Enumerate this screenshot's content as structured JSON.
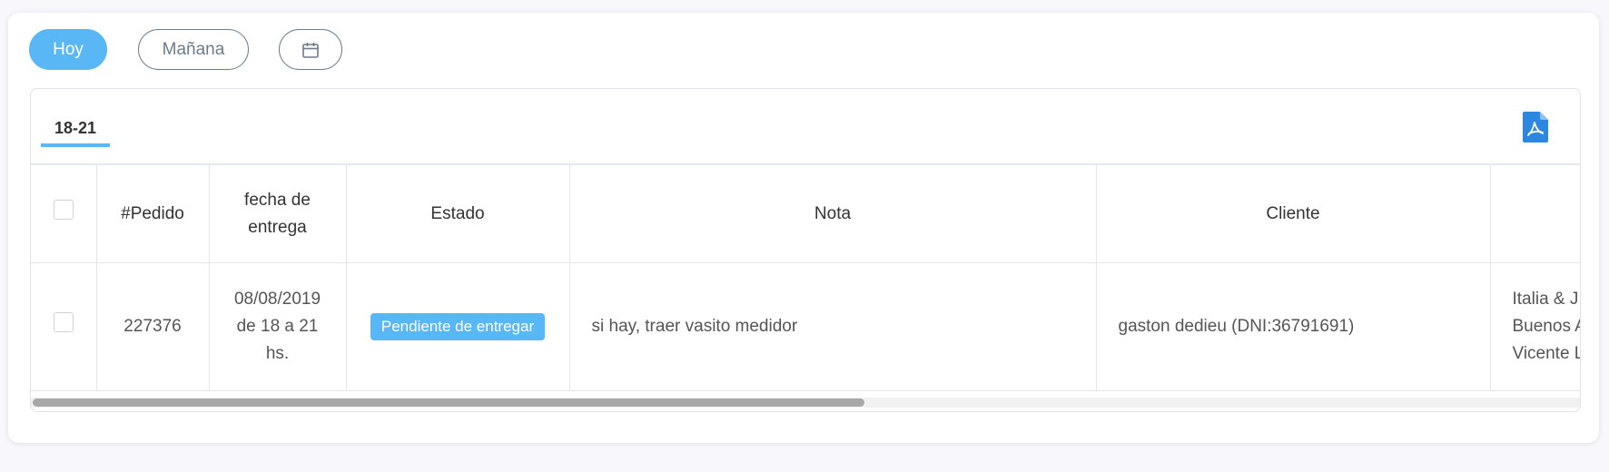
{
  "filters": {
    "hoy_label": "Hoy",
    "manana_label": "Mañana",
    "calendar_icon": "calendar-icon",
    "active_color": "#5ab7f5"
  },
  "tabs": [
    {
      "label": "18-21",
      "active": true
    }
  ],
  "export": {
    "icon": "pdf-file-icon",
    "color": "#2b87e0"
  },
  "table": {
    "headers": {
      "pedido": "#Pedido",
      "fecha_line1": "fecha de",
      "fecha_line2": "entrega",
      "estado": "Estado",
      "nota": "Nota",
      "cliente": "Cliente"
    },
    "rows": [
      {
        "pedido": "227376",
        "fecha_line1": "08/08/2019",
        "fecha_line2": "de 18 a 21",
        "fecha_line3": "hs.",
        "estado": "Pendiente de entregar",
        "nota": "si hay, traer vasito medidor",
        "cliente": "gaston dedieu (DNI:36791691)",
        "direccion_line1": "Italia & J",
        "direccion_line2": "Buenos A",
        "direccion_line3": "Vicente L"
      }
    ]
  },
  "scrollbar": {
    "position_fraction": 0.0,
    "visible_fraction": 0.54
  }
}
